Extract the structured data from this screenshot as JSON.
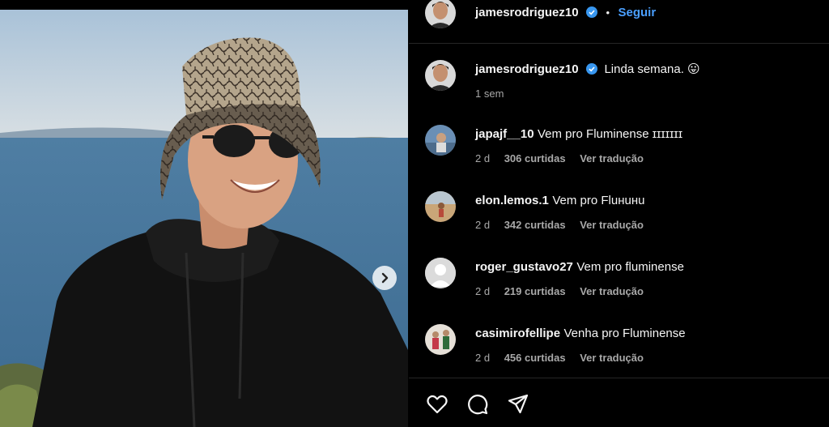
{
  "post": {
    "author": "jamesrodriguez10",
    "follow_label": "Seguir",
    "separator": "•",
    "caption": "Linda semana. 😛",
    "caption_time": "1 sem",
    "verified_icon": "verified-badge-icon"
  },
  "comments": [
    {
      "user": "japajf__10",
      "text": "Vem pro Fluminense ɪɪɪɪɪɪɪ",
      "time": "2 d",
      "likes": "306 curtidas",
      "translate": "Ver tradução"
    },
    {
      "user": "elon.lemos.1",
      "text": "Vem pro Fluнuнu",
      "time": "2 d",
      "likes": "342 curtidas",
      "translate": "Ver tradução"
    },
    {
      "user": "roger_gustavo27",
      "text": "Vem pro fluminense",
      "time": "2 d",
      "likes": "219 curtidas",
      "translate": "Ver tradução"
    },
    {
      "user": "casimirofellipe",
      "text": "Venha pro Fluminense",
      "time": "2 d",
      "likes": "456 curtidas",
      "translate": "Ver tradução"
    }
  ],
  "actions": [
    "heart-icon",
    "comment-icon",
    "share-icon"
  ],
  "colors": {
    "link": "#4a9fff",
    "muted": "#a8a8a8",
    "verified": "#3897f0"
  }
}
